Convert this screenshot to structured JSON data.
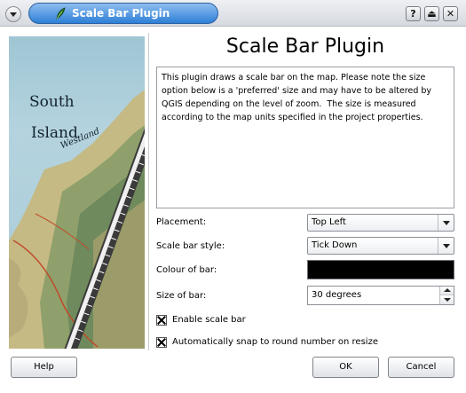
{
  "window": {
    "title": "Scale Bar Plugin",
    "buttons": {
      "help": "?",
      "shade": "⏏",
      "close": "✕"
    }
  },
  "map": {
    "labels": {
      "south": "South",
      "island": "Island",
      "westland": "Westland"
    },
    "colors": {
      "sea": "#a9cbd6",
      "land": "#c9bf86",
      "mountain": "#6f8a5d"
    }
  },
  "main": {
    "heading": "Scale Bar Plugin",
    "description": "This plugin draws a scale bar on the map. Please note the size option below is a 'preferred' size and may have to be altered by QGIS depending on the level of zoom.  The size is measured according to the map units specified in the project properties."
  },
  "form": {
    "placement": {
      "label": "Placement:",
      "value": "Top Left"
    },
    "style": {
      "label": "Scale bar style:",
      "value": "Tick Down"
    },
    "colour": {
      "label": "Colour of bar:",
      "value": "#000000"
    },
    "size": {
      "label": "Size of bar:",
      "value": "30 degrees"
    },
    "enable": {
      "label": "Enable scale bar",
      "checked": true
    },
    "snap": {
      "label": "Automatically snap to round number on resize",
      "checked": true
    }
  },
  "footer": {
    "help": "Help",
    "ok": "OK",
    "cancel": "Cancel"
  }
}
